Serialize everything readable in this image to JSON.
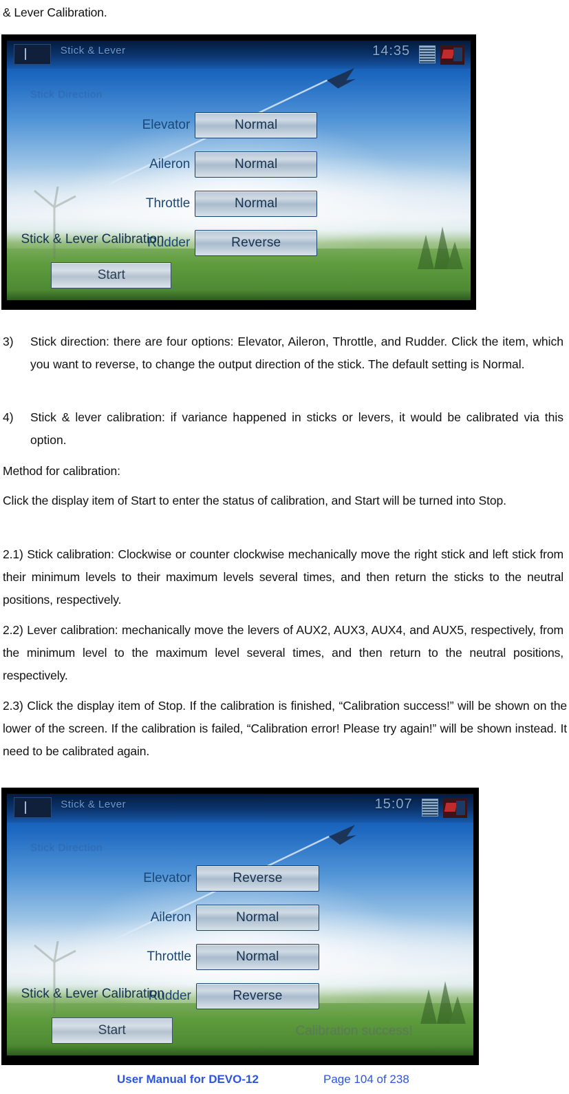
{
  "document": {
    "heading_fragment": "& Lever Calibration."
  },
  "paragraphs": {
    "item3": {
      "number": "3)",
      "text": "Stick direction: there are four options: Elevator, Aileron, Throttle, and Rudder. Click the item, which you want to reverse, to change the output direction of the stick. The default setting is Normal."
    },
    "item4": {
      "number": "4)",
      "text": "Stick & lever calibration: if variance happened in sticks or levers, it would be calibrated via this option."
    },
    "method_heading": "Method for calibration:",
    "method_intro": "Click the display item of Start to enter the status of calibration, and Start will be turned into Stop.",
    "step21": "2.1) Stick calibration: Clockwise or counter clockwise mechanically move the right stick and left stick from their minimum levels to their maximum levels several times, and then return the sticks to the neutral positions, respectively.",
    "step22": "2.2) Lever calibration: mechanically move the levers of AUX2, AUX3, AUX4, and AUX5, respectively, from the minimum level to the maximum level several times, and then return to the neutral positions, respectively.",
    "step23": "2.3) Click the display item of Stop. If the calibration is finished, “Calibration success!” will be shown on the lower of the screen. If the calibration is failed, “Calibration error! Please try again!” will be shown instead. It need to be calibrated again."
  },
  "screenshot_top": {
    "status_bar": {
      "icon": "menu-back-icon",
      "title": "Stick & Lever",
      "time": "14:35",
      "battery_icon": "battery-icon",
      "rf_icon": "rf-signal-icon"
    },
    "section_label": "Stick Direction",
    "rows": [
      {
        "label": "Elevator",
        "value": "Normal"
      },
      {
        "label": "Aileron",
        "value": "Normal"
      },
      {
        "label": "Throttle",
        "value": "Normal"
      },
      {
        "label": "Rudder",
        "value": "Reverse"
      }
    ],
    "calibration_label": "Stick & Lever Calibration",
    "start_button": "Start",
    "result_message": ""
  },
  "screenshot_bottom": {
    "status_bar": {
      "icon": "menu-back-icon",
      "title": "Stick & Lever",
      "time": "15:07",
      "battery_icon": "battery-icon",
      "rf_icon": "rf-signal-icon"
    },
    "section_label": "Stick Direction",
    "rows": [
      {
        "label": "Elevator",
        "value": "Reverse"
      },
      {
        "label": "Aileron",
        "value": "Normal"
      },
      {
        "label": "Throttle",
        "value": "Normal"
      },
      {
        "label": "Rudder",
        "value": "Reverse"
      }
    ],
    "calibration_label": "Stick & Lever Calibration",
    "start_button": "Start",
    "result_message": "Calibration success!"
  },
  "footer": {
    "manual_title": "User Manual for DEVO-12",
    "page_label": "Page 104 of 238",
    "color": "#2b55e0"
  }
}
